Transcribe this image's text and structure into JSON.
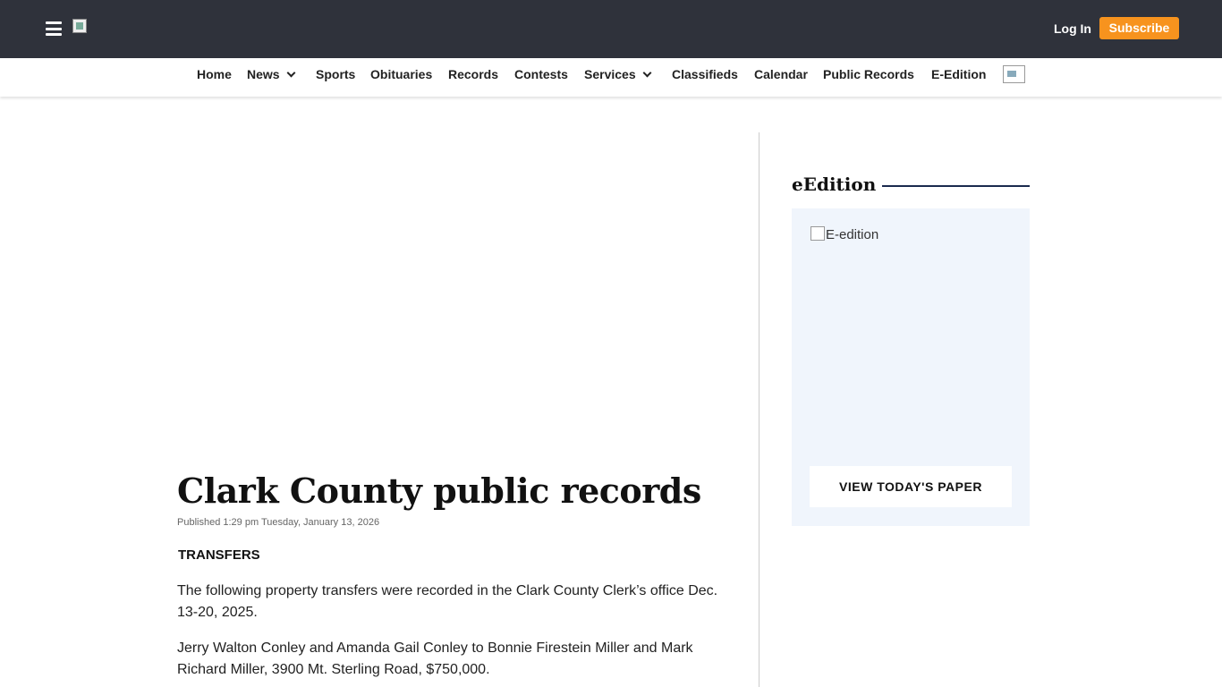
{
  "header": {
    "login_label": "Log In",
    "subscribe_label": "Subscribe",
    "subscribe_color": "#f7931e",
    "bg_color": "#2f323b"
  },
  "nav": {
    "items": [
      {
        "label": "Home"
      },
      {
        "label": "News",
        "dropdown": true
      },
      {
        "label": "Sports"
      },
      {
        "label": "Obituaries"
      },
      {
        "label": "Records"
      },
      {
        "label": "Contests"
      },
      {
        "label": "Services",
        "dropdown": true
      },
      {
        "label": "Classifieds"
      },
      {
        "label": "Calendar"
      },
      {
        "label": "Public Records"
      },
      {
        "label": "E-Edition"
      }
    ]
  },
  "article": {
    "headline": "Clark County public records",
    "published": "Published 1:29 pm Tuesday, January 13, 2026",
    "section": "TRANSFERS",
    "paragraphs": [
      "The following property transfers were recorded in the Clark County Clerk’s office Dec. 13-20, 2025.",
      "Jerry Walton Conley and Amanda Gail Conley to Bonnie Firestein Miller and Mark Richard Miller, 3900 Mt. Sterling Road, $750,000."
    ]
  },
  "sidebar": {
    "edition_title": "eEdition",
    "edition_image_alt": "E-edition",
    "view_button": "VIEW TODAY'S PAPER"
  }
}
